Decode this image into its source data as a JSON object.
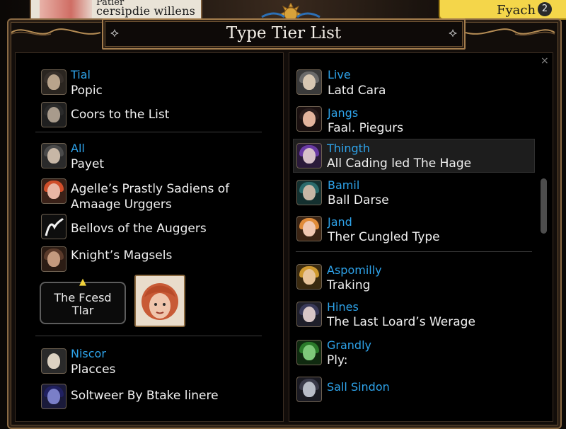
{
  "header": {
    "top_card_line1": "Patier",
    "top_card_line2": "cersipdie willens",
    "top_right_label": "Fyach",
    "top_right_badge": "2",
    "title": "Type Tier List",
    "title_ornament": "⟡"
  },
  "left_panel": {
    "groups": [
      {
        "items": [
          {
            "category": "Tial",
            "label": "Popic",
            "avatar_colors": [
              "#b9a48c",
              "#37302b"
            ]
          },
          {
            "category": "",
            "label": "Coors to the List",
            "avatar_colors": [
              "#a89b8c",
              "#2a2a2a"
            ]
          }
        ]
      },
      {
        "items": [
          {
            "category": "All",
            "label": "Payet",
            "avatar_colors": [
              "#c7b7a6",
              "#4a4a4a"
            ]
          },
          {
            "category": "",
            "label": "Agelle’s Prastly Sadiens of",
            "label2": "Amaage Urggers",
            "avatar_colors": [
              "#e9b6a4",
              "#d04e2a"
            ]
          },
          {
            "category": "",
            "label": "Bellovs of the Auggers",
            "avatar_colors": [
              "#f2f2f2",
              "#111111"
            ]
          },
          {
            "category": "",
            "label": "Knight’s Magsels",
            "avatar_colors": [
              "#c49a7e",
              "#5a3a2a"
            ]
          }
        ]
      },
      {
        "items": [
          {
            "category": "Niscor",
            "label": "Placces",
            "avatar_colors": [
              "#dcd2c2",
              "#2a2a2a"
            ]
          },
          {
            "category": "",
            "label": "Soltweer By Btake linere",
            "avatar_colors": [
              "#7a7fc8",
              "#202060"
            ]
          }
        ]
      }
    ],
    "featured_label_line1": "The Fcesd",
    "featured_label_line2": "Tlar"
  },
  "right_panel": {
    "groups": [
      {
        "items": [
          {
            "category": "Live",
            "label": "Latd Cara",
            "avatar_colors": [
              "#d7c7b2",
              "#6a6a6a"
            ]
          },
          {
            "category": "Jangs",
            "label": "Faal. Piegurs",
            "avatar_colors": [
              "#e3b49d",
              "#2a1d1d"
            ]
          },
          {
            "category": "Thingth",
            "label": "All Cading led The Hage",
            "avatar_colors": [
              "#d7c1c9",
              "#6a3aa5"
            ],
            "selected": true
          },
          {
            "category": "Bamil",
            "label": "Ball Darse",
            "avatar_colors": [
              "#c8b7a5",
              "#2a6b6b"
            ]
          },
          {
            "category": "Jand",
            "label": "Ther Cungled Type",
            "avatar_colors": [
              "#f0c8b2",
              "#e08c3a"
            ]
          }
        ]
      },
      {
        "items": [
          {
            "category": "Aspomilly",
            "label": "Traking",
            "avatar_colors": [
              "#e8c49a",
              "#d09a30"
            ]
          },
          {
            "category": "Hines",
            "label": "The Last Loard’s Werage",
            "avatar_colors": [
              "#d8c6c6",
              "#3a3a5a"
            ]
          },
          {
            "category": "Grandly",
            "label": "Ply:",
            "avatar_colors": [
              "#7ec97a",
              "#2a7a2a"
            ]
          },
          {
            "category": "Sall Sindon",
            "label": "",
            "avatar_colors": [
              "#b8bcc7",
              "#3a3a4a"
            ]
          }
        ]
      }
    ],
    "close_glyph": "×"
  }
}
